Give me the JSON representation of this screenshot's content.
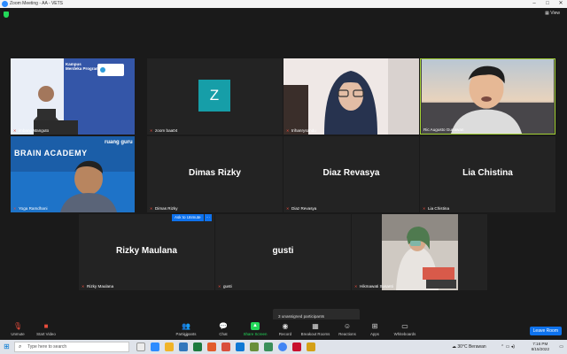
{
  "window": {
    "title": "Zoom Meeting - AA - VETS"
  },
  "tiles": [
    {
      "name": "imbang Manguto",
      "banner": "Kampus\nMerdeka Program"
    },
    {
      "name": "zoom baa04",
      "avatar_letter": "Z"
    },
    {
      "name": "trihanrysandu"
    },
    {
      "name": "Ric Augusto Gunawan"
    },
    {
      "name": "Yoga Ramdhani",
      "banner": "BRAIN ACADEMY",
      "banner2": "ruang guru"
    },
    {
      "name": "Dimas Rizky",
      "display": "Dimas Rizky"
    },
    {
      "name": "Diaz Revasya",
      "display": "Diaz Revasya"
    },
    {
      "name": "Lia Chistina",
      "display": "Lia Chistina"
    },
    {
      "name": "Rizky Maulana",
      "display": "Rizky Maulana"
    },
    {
      "name": "gusti",
      "display": "gusti"
    },
    {
      "name": "Hikmawati Susanti"
    }
  ],
  "ask_to_unmute": {
    "label": "Ask to Unmute",
    "more": "···"
  },
  "unassigned": "3 unassigned participants",
  "toolbar": {
    "unmute": "Unmute",
    "start_video": "Start Video",
    "participants": "Participants",
    "participants_count": "11",
    "chat": "Chat",
    "share_screen": "Share Screen",
    "record": "Record",
    "breakout_rooms": "Breakout Rooms",
    "reactions": "Reactions",
    "apps": "Apps",
    "whiteboards": "Whiteboards",
    "leave": "Leave Room"
  },
  "taskbar": {
    "search_placeholder": "Type here to search",
    "weather": "30°C  Berawan",
    "time": "7:16 PM",
    "date": "8/15/2022"
  },
  "colors": {
    "accent": "#0e72ed",
    "active_border": "#a4d235",
    "share_green": "#23d959"
  }
}
